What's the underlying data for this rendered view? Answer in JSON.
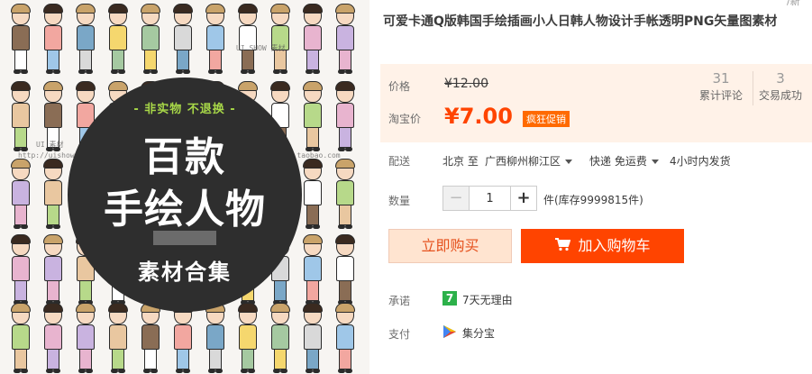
{
  "image": {
    "badge_top": "- 非实物 不退换 -",
    "badge_line1": "百款",
    "badge_line2": "手绘人物",
    "badge_bottom": "素材合集",
    "watermark_1": "UI 素材",
    "watermark_2": "http://uishow.ta",
    "watermark_3": "UI SHOW 素材",
    "watermark_4": "http://uishow.taobao.com"
  },
  "product": {
    "title": "可爱卡通Q版韩国手绘插画小人日韩人物设计手帐透明PNG矢量图素材",
    "corner_text": "/新"
  },
  "price": {
    "price_label": "价格",
    "original_price": "¥12.00",
    "taobao_label": "淘宝价",
    "current_price": "¥7.00",
    "promo_tag": "疯狂促销",
    "reviews_count": "31",
    "reviews_label": "累计评论",
    "sales_count": "3",
    "sales_label": "交易成功"
  },
  "shipping": {
    "label": "配送",
    "from": "北京 至",
    "to": "广西柳州柳江区",
    "method": "快递 免运费",
    "dispatch": "4小时内发货"
  },
  "quantity": {
    "label": "数量",
    "minus": "−",
    "value": "1",
    "plus": "+",
    "stock": "件(库存9999815件)"
  },
  "actions": {
    "buy_now": "立即购买",
    "add_to_cart": "加入购物车"
  },
  "promise": {
    "label": "承诺",
    "icon_text": "7",
    "text": "7天无理由"
  },
  "payment": {
    "label": "支付",
    "text": "集分宝"
  },
  "colors": {
    "accent": "#ff4400",
    "price_bg": "#fff2e8",
    "promise_green": "#2cb14a",
    "badge_green": "#a8d848"
  }
}
